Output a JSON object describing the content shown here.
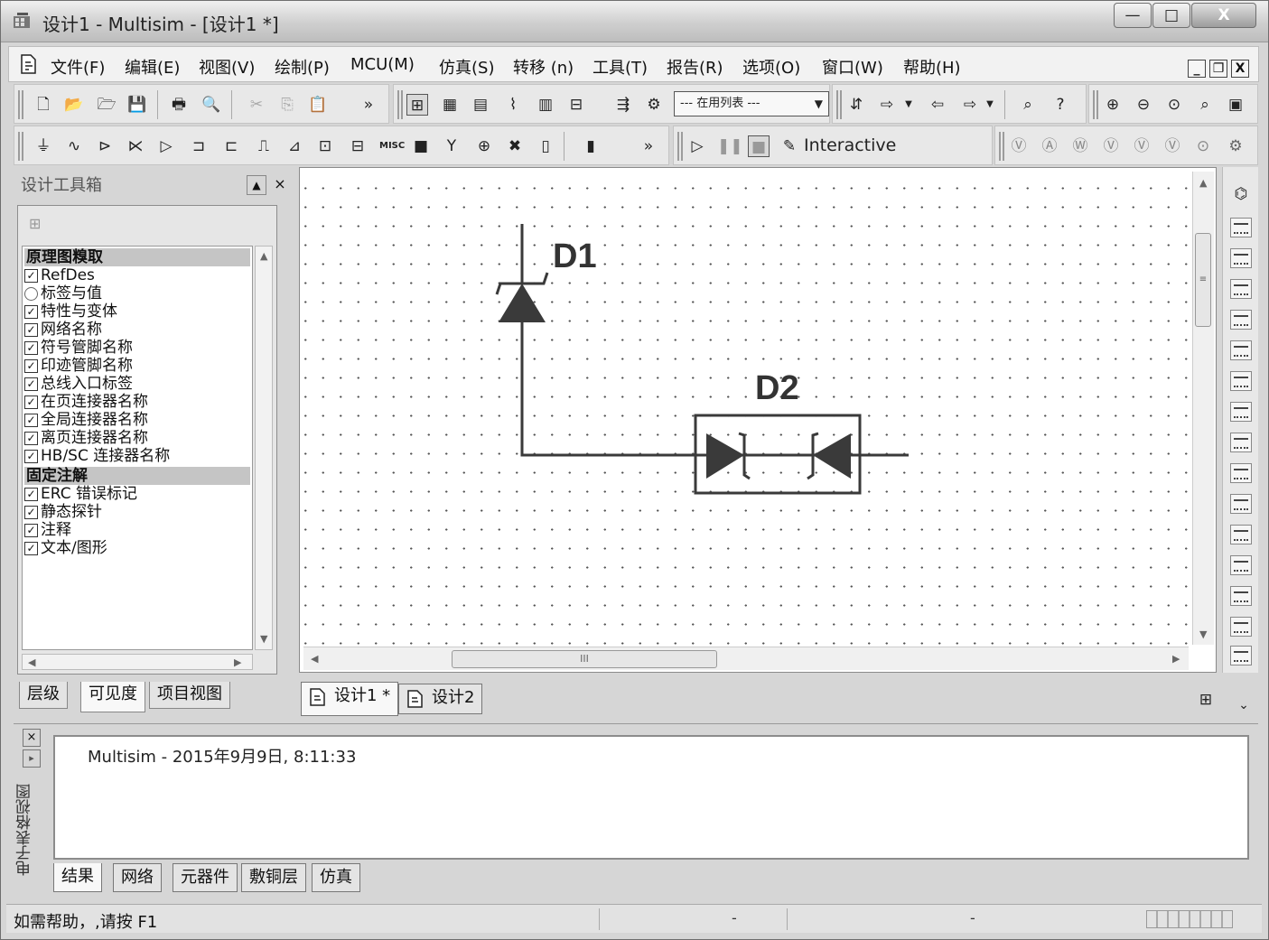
{
  "window": {
    "title": "设计1 - Multisim - [设计1 *]",
    "controls": {
      "minimize": "—",
      "maximize": "□",
      "close": "X"
    }
  },
  "menubar": {
    "items": [
      "文件(F)",
      "编辑(E)",
      "视图(V)",
      "绘制(P)",
      "MCU(M)",
      "仿真(S)",
      "转移 (n)",
      "工具(T)",
      "报告(R)",
      "选项(O)",
      "窗口(W)",
      "帮助(H)"
    ],
    "mdi": {
      "minimize": "_",
      "restore": "❐",
      "close": "X"
    }
  },
  "toolbar": {
    "inuse_list": "--- 在用列表 ---",
    "chevron": "»",
    "interactive_label": "Interactive"
  },
  "toolbox": {
    "title": "设计工具箱",
    "pin": "▲",
    "close": "×",
    "groups": [
      {
        "name": "原理图糗取",
        "items": [
          {
            "label": "RefDes",
            "checked": true
          },
          {
            "label": "标签与值",
            "checked": false
          },
          {
            "label": "特性与变体",
            "checked": true
          },
          {
            "label": "网络名称",
            "checked": true
          },
          {
            "label": "符号管脚名称",
            "checked": true
          },
          {
            "label": "印迹管脚名称",
            "checked": true
          },
          {
            "label": "总线入口标签",
            "checked": true
          },
          {
            "label": "在页连接器名称",
            "checked": true
          },
          {
            "label": "全局连接器名称",
            "checked": true
          },
          {
            "label": "离页连接器名称",
            "checked": true
          },
          {
            "label": "HB/SC 连接器名称",
            "checked": true
          }
        ]
      },
      {
        "name": "固定注解",
        "items": [
          {
            "label": "ERC 错误标记",
            "checked": true
          },
          {
            "label": "静态探针",
            "checked": true
          },
          {
            "label": "注释",
            "checked": true
          },
          {
            "label": "文本/图形",
            "checked": true
          }
        ]
      }
    ],
    "tabs": [
      "层级",
      "可见度",
      "项目视图"
    ],
    "active_tab": "可见度"
  },
  "schematic": {
    "components": [
      {
        "refdes": "D1",
        "type": "zener-diode"
      },
      {
        "refdes": "D2",
        "type": "dual-zener-diode"
      }
    ],
    "hscroll_grip": "III",
    "vscroll_grip": "≡"
  },
  "design_tabs": [
    {
      "label": "设计1 *",
      "active": true
    },
    {
      "label": "设计2",
      "active": false
    }
  ],
  "spreadsheet": {
    "title": "电子表格视图",
    "message": "Multisim  -  2015年9月9日, 8:11:33",
    "close": "×",
    "pin": "▸",
    "tabs": [
      "结果",
      "网络",
      "元器件",
      "敷铜层",
      "仿真"
    ],
    "active_tab": "结果"
  },
  "statusbar": {
    "text": "如需帮助，,请按 F1",
    "cell1": "-",
    "cell2": "-"
  },
  "colors": {
    "window_bg": "#d6d6d6",
    "canvas_bg": "#ffffff",
    "wire": "#3a3a3a",
    "grid_dot": "#555555"
  }
}
